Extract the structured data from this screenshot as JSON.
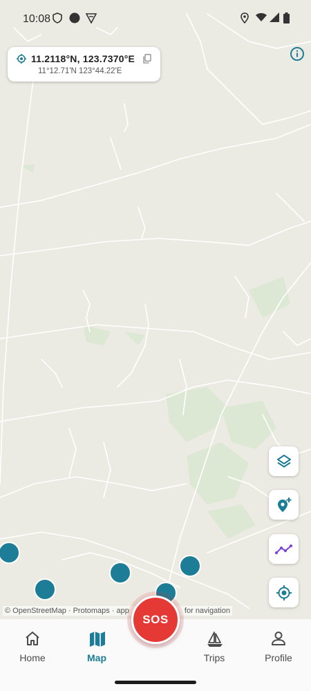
{
  "status_bar": {
    "time": "10:08"
  },
  "coordinates": {
    "decimal": "11.2118°N, 123.7370°E",
    "dms": "11°12.71'N  123°44.22'E"
  },
  "attribution": "© OpenStreetMap · Protomaps · app",
  "attribution_tail": "for navigation",
  "sos_label": "SOS",
  "nav": {
    "home": "Home",
    "map": "Map",
    "trips": "Trips",
    "profile": "Profile",
    "active": "map"
  },
  "colors": {
    "accent": "#1e7d96",
    "sos": "#e53935",
    "route": "#7b3fe4",
    "map_bg": "#ecebe3"
  }
}
